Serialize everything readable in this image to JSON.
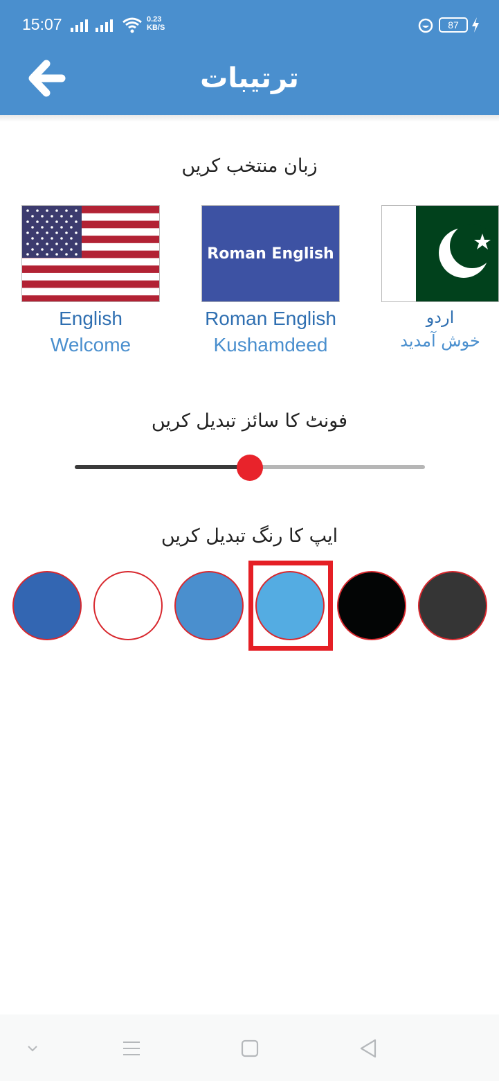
{
  "status": {
    "time": "15:07",
    "net_speed_value": "0.23",
    "net_speed_unit": "KB/S",
    "battery": "87"
  },
  "header": {
    "title": "ترتیبات"
  },
  "language": {
    "title": "زبان منتخب کریں",
    "options": [
      {
        "name": "English",
        "greeting": "Welcome"
      },
      {
        "name": "Roman English",
        "greeting": "Kushamdeed",
        "flag_text": "Roman English"
      },
      {
        "name": "اردو",
        "greeting": "خوش آمدید"
      }
    ]
  },
  "font_size": {
    "title": "فونٹ کا سائز تبدیل کریں",
    "value_fraction": 0.5
  },
  "app_color": {
    "title": "ایپ کا رنگ تبدیل کریں",
    "colors": [
      "#3366b2",
      "#ffffff",
      "#4a8fce",
      "#54ace2",
      "#030505",
      "#353535"
    ],
    "selected_index": 3
  }
}
